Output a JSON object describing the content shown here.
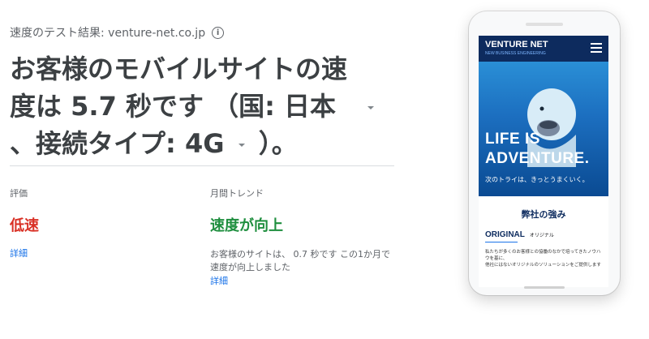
{
  "header": {
    "test_label": "速度のテスト結果: venture-net.co.jp",
    "info_icon": "info-icon"
  },
  "headline": {
    "line1": "お客様のモバイルサイトの速",
    "line2a": "度は 5.7 秒です （国: 日本",
    "line3a": "、接続タイプ: 4G",
    "line3b": " ）。"
  },
  "rating_section": {
    "title": "評価",
    "value": "低速",
    "link": "詳細"
  },
  "trend_section": {
    "title": "月間トレンド",
    "value": "速度が向上",
    "description": "お客様のサイトは、 0.7 秒です この1か月で速度が向上しました",
    "link": "詳細"
  },
  "phone_preview": {
    "site_logo": "VENTURE NET",
    "site_tagline": "NEW BUSINESS ENGINEERING",
    "hero_title_line1": "LIFE IS",
    "hero_title_line2": "ADVENTURE.",
    "hero_subtitle": "次のトライは、きっとうまくいく。",
    "section_title": "弊社の強み",
    "original_en": "ORIGINAL",
    "original_jp": "オリジナル",
    "body_line1": "私たちが多くのお客様との協働のなかで培ってきたノウハウを基に、",
    "body_line2": "他社にはないオリジナルのソリューションをご提供します"
  },
  "colors": {
    "slow": "#d93025",
    "improving": "#1e8e3e",
    "link": "#1a73e8",
    "site_navy": "#0d2b5e"
  }
}
